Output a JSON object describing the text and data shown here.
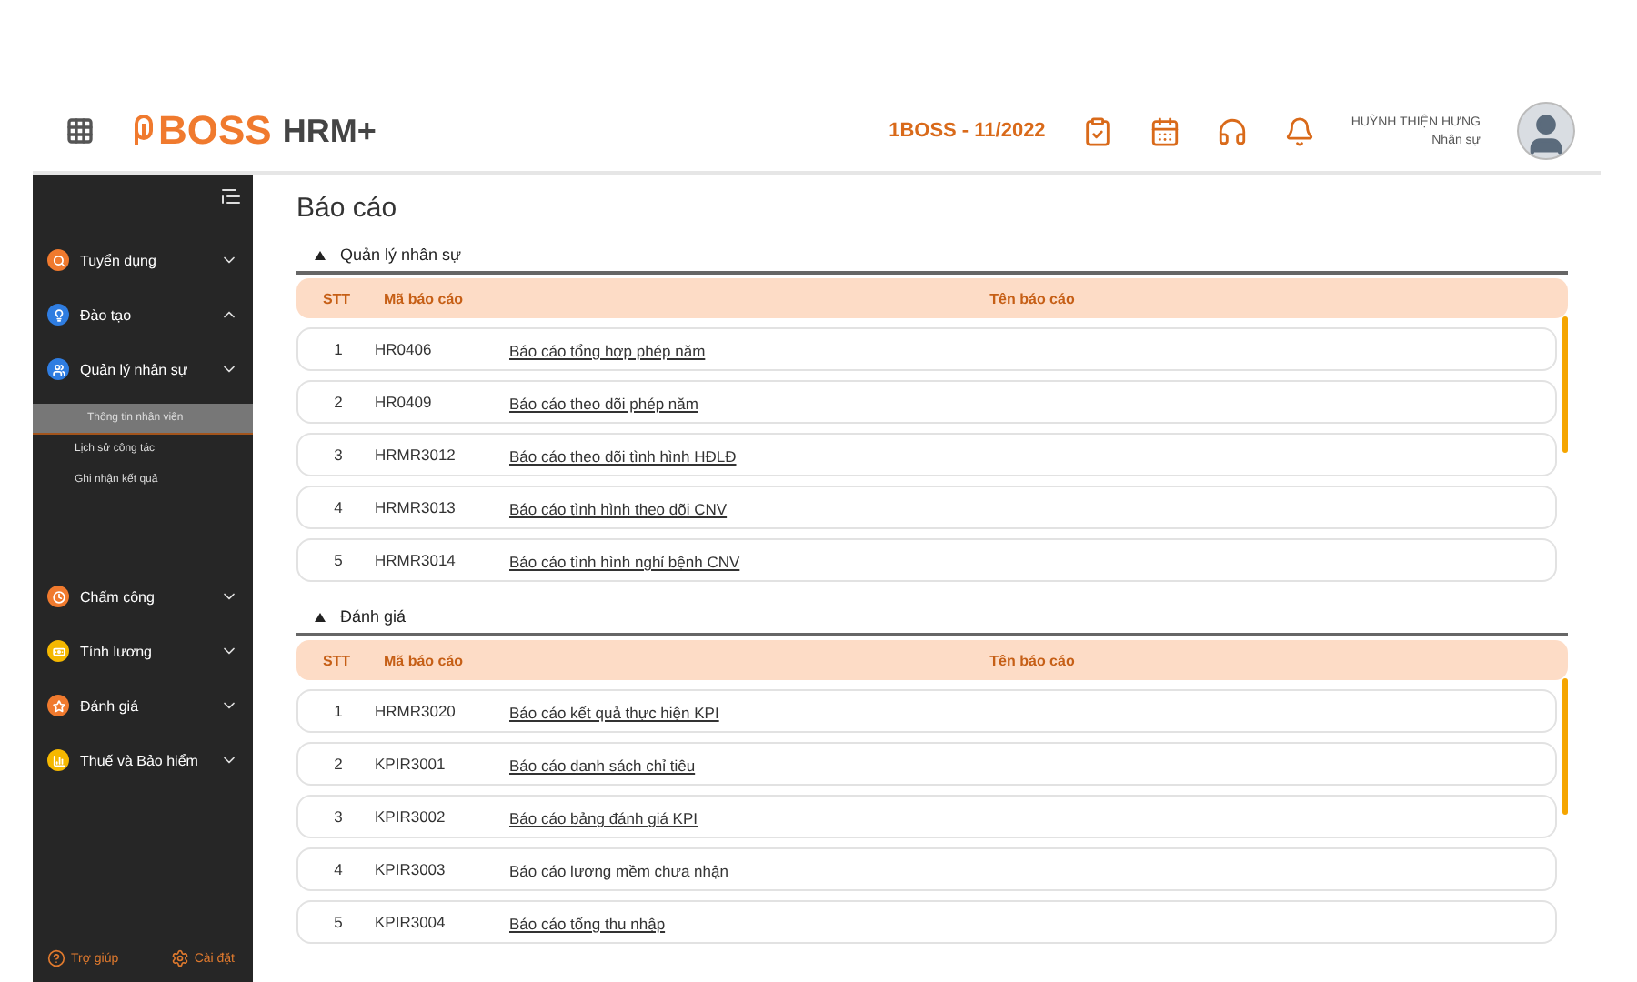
{
  "header": {
    "logo_mark": "BOSS",
    "product": "HRM+",
    "period": "1BOSS - 11/2022",
    "user": {
      "name": "HUỲNH THIỆN HƯNG",
      "role": "Nhân sự"
    }
  },
  "sidebar": {
    "items": [
      {
        "label": "Tuyển dụng",
        "kind": "search",
        "color": "#f07a2e",
        "expanded": false
      },
      {
        "label": "Đào tạo",
        "kind": "bulb",
        "color": "#2f7de1",
        "expanded": true
      },
      {
        "label": "Quản lý nhân sự",
        "kind": "people",
        "color": "#2f7de1",
        "expanded": false,
        "children": [
          {
            "label": "Thông tin nhân viên",
            "selected": true
          },
          {
            "label": "Lịch sử công tác",
            "selected": false
          },
          {
            "label": "Ghi nhận kết quả",
            "selected": false
          }
        ]
      },
      {
        "label": "Chấm công",
        "kind": "clock",
        "color": "#f07a2e",
        "expanded": false
      },
      {
        "label": "Tính lương",
        "kind": "money",
        "color": "#f5b800",
        "expanded": false
      },
      {
        "label": "Đánh giá",
        "kind": "star",
        "color": "#f07a2e",
        "expanded": false
      },
      {
        "label": "Thuế và Bảo hiểm",
        "kind": "chart",
        "color": "#f5b800",
        "expanded": false
      }
    ],
    "footer": [
      {
        "label": "Trợ giúp",
        "kind": "help"
      },
      {
        "label": "Cài đặt",
        "kind": "settings"
      }
    ]
  },
  "page_title": "Báo cáo",
  "sections": [
    {
      "title": "Quản lý nhân sự",
      "expanded": true,
      "columns": [
        "STT",
        "Mã báo cáo",
        "Tên báo cáo"
      ],
      "rows": [
        {
          "index": "1",
          "code": "HR0406",
          "name": "Báo cáo tổng hợp phép năm",
          "link": true
        },
        {
          "index": "2",
          "code": "HR0409",
          "name": "Báo cáo theo dõi phép năm",
          "link": true
        },
        {
          "index": "3",
          "code": "HRMR3012",
          "name": "Báo cáo theo dõi tình hình HĐLĐ",
          "link": true
        },
        {
          "index": "4",
          "code": "HRMR3013",
          "name": "Báo cáo tình hình theo dõi CNV",
          "link": true
        },
        {
          "index": "5",
          "code": "HRMR3014",
          "name": "Báo cáo tình hình nghỉ bệnh CNV",
          "link": true
        }
      ]
    },
    {
      "title": "Đánh giá",
      "expanded": true,
      "columns": [
        "STT",
        "Mã báo cáo",
        "Tên báo cáo"
      ],
      "rows": [
        {
          "index": "1",
          "code": "HRMR3020",
          "name": "Báo cáo kết quả thực hiện KPI",
          "link": true
        },
        {
          "index": "2",
          "code": "KPIR3001",
          "name": "Báo cáo danh sách chỉ tiêu",
          "link": true
        },
        {
          "index": "3",
          "code": "KPIR3002",
          "name": "Báo cáo bảng đánh giá KPI",
          "link": true
        },
        {
          "index": "4",
          "code": "KPIR3003",
          "name": "Báo cáo lương mềm chưa nhận",
          "link": false
        },
        {
          "index": "5",
          "code": "KPIR3004",
          "name": "Báo cáo tổng thu nhập",
          "link": true
        }
      ]
    }
  ]
}
